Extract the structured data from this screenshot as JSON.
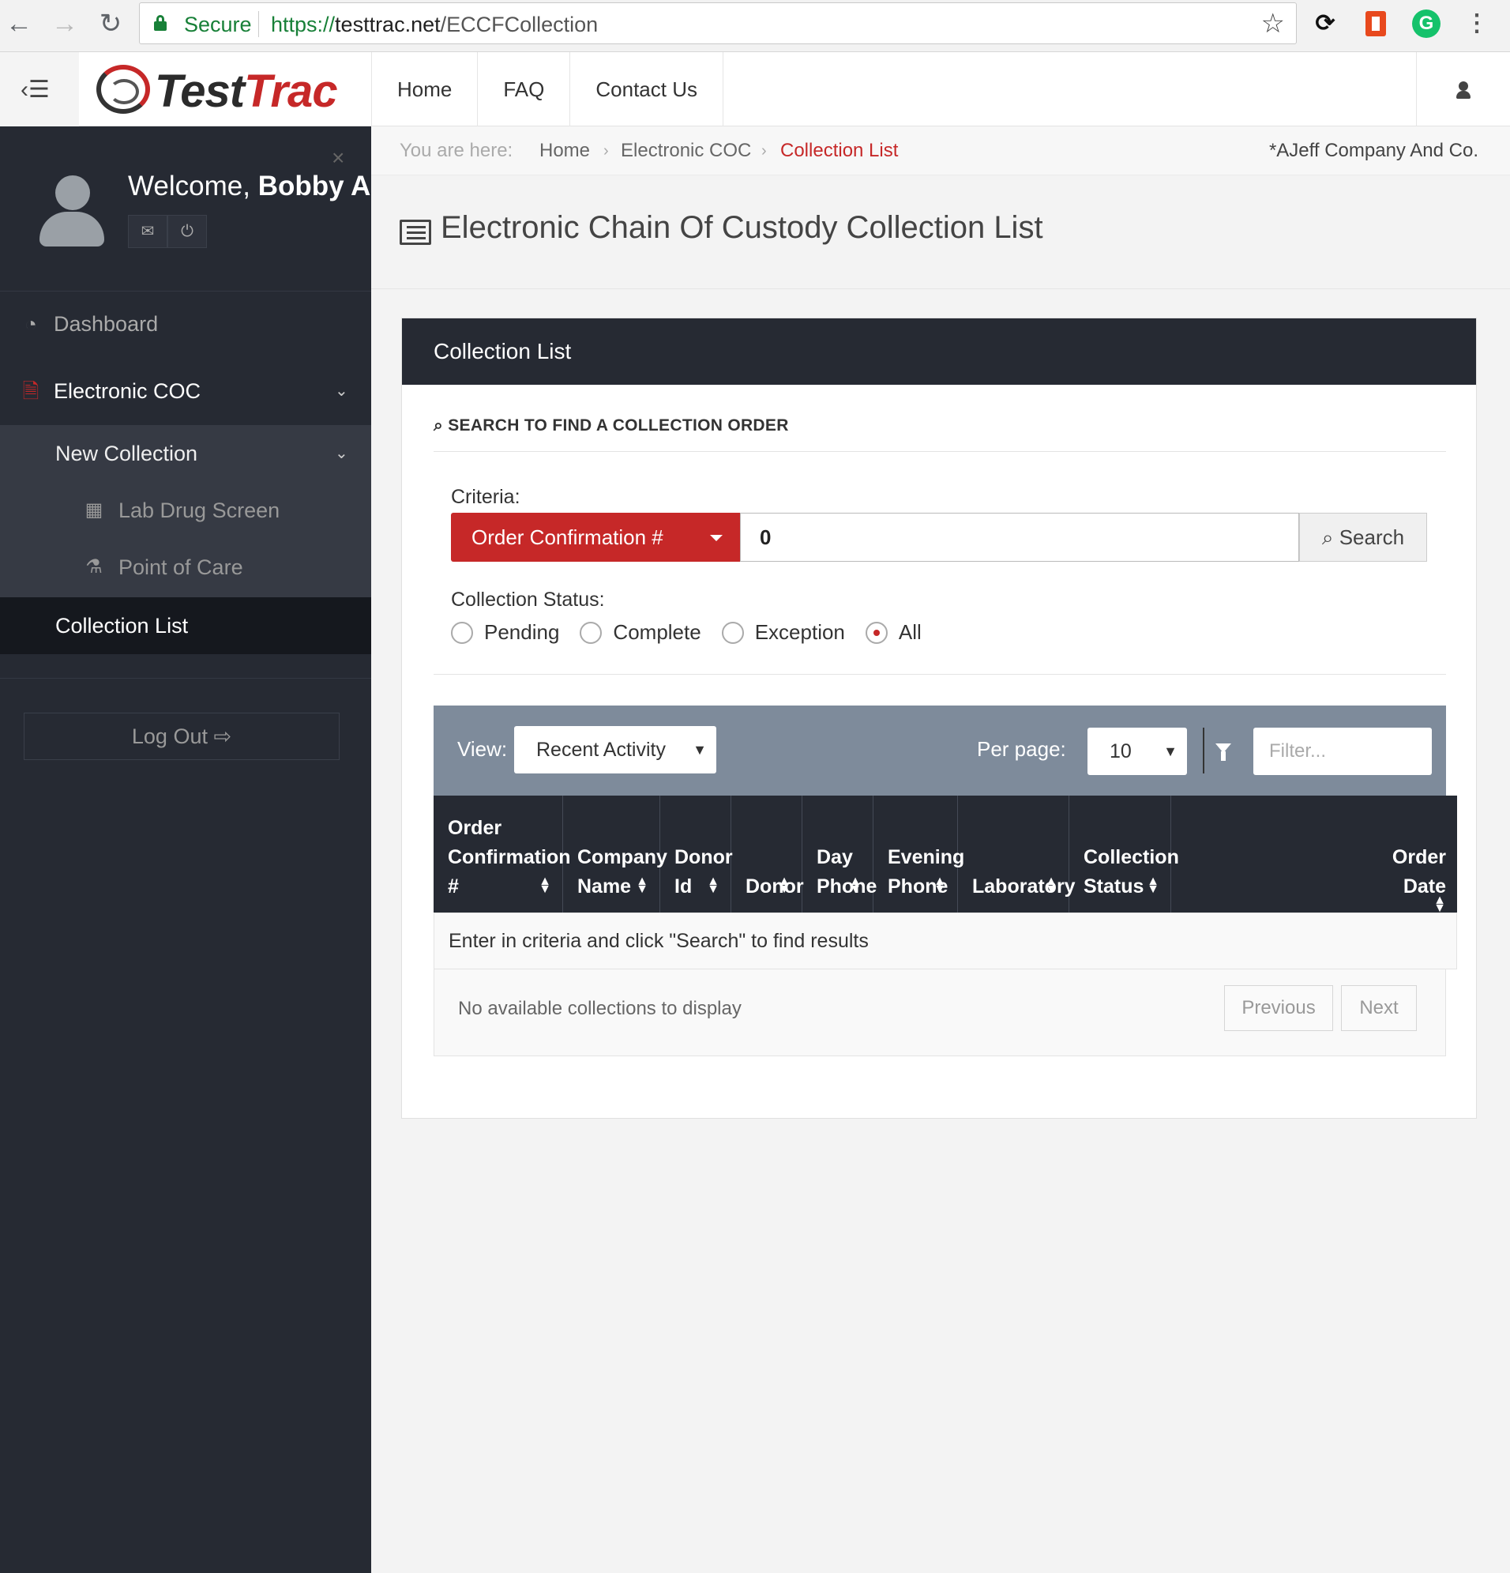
{
  "browser": {
    "secure_label": "Secure",
    "url_protocol": "https://",
    "url_host": "testtrac.net",
    "url_path": "/ECCFCollection"
  },
  "header": {
    "logo_part1": "Test",
    "logo_part2": "Trac",
    "nav": [
      "Home",
      "FAQ",
      "Contact Us"
    ]
  },
  "sidebar": {
    "welcome_prefix": "Welcome, ",
    "user_name": "Bobby A",
    "dashboard": "Dashboard",
    "electronic_coc": "Electronic COC",
    "new_collection": "New Collection",
    "lab_drug_screen": "Lab Drug Screen",
    "point_of_care": "Point of Care",
    "collection_list": "Collection List",
    "logout": "Log Out"
  },
  "breadcrumb": {
    "you_are_here": "You are here:",
    "items": [
      "Home",
      "Electronic COC",
      "Collection List"
    ],
    "company": "*AJeff Company And Co."
  },
  "page": {
    "title": "Electronic Chain Of Custody Collection List"
  },
  "panel": {
    "title": "Collection List",
    "search_heading": "SEARCH TO FIND A COLLECTION ORDER",
    "criteria_label": "Criteria:",
    "criteria_option": "Order Confirmation #",
    "criteria_value": "0",
    "search_button": "Search",
    "status_label": "Collection Status:",
    "statuses": [
      "Pending",
      "Complete",
      "Exception",
      "All"
    ],
    "selected_status": "All"
  },
  "grid": {
    "view_label": "View:",
    "view_value": "Recent Activity",
    "per_page_label": "Per page:",
    "per_page_value": "10",
    "filter_placeholder": "Filter...",
    "columns": [
      "Order\nConfirmation\n#",
      "Company\nName",
      "Donor\nId",
      "Donor",
      "Day\nPhone",
      "Evening\nPhone",
      "Laboratory",
      "Collection\nStatus",
      "Order\nDate"
    ],
    "empty_message": "Enter in criteria and click \"Search\" to find results",
    "no_results": "No available collections to display",
    "previous": "Previous",
    "next": "Next"
  },
  "colors": {
    "accent_red": "#c62828",
    "sidebar_bg": "#262a33",
    "grid_toolbar": "#7e8b9b"
  }
}
